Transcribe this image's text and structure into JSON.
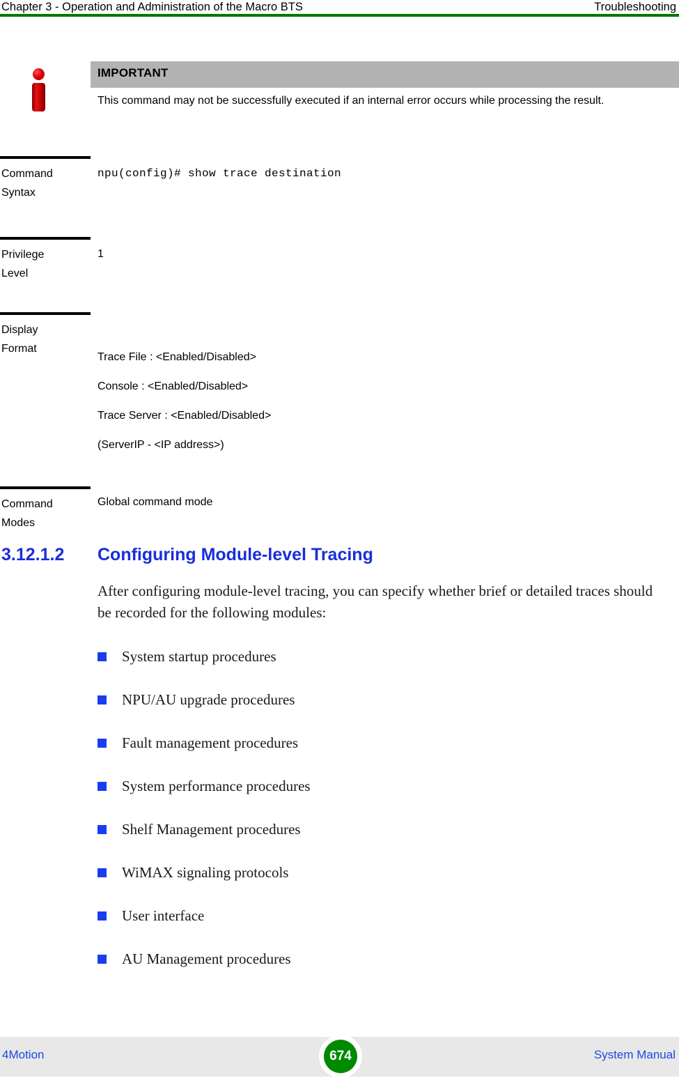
{
  "header": {
    "left": "Chapter 3 - Operation and Administration of the Macro BTS",
    "right": "Troubleshooting",
    "rule_color": "#007700"
  },
  "callout": {
    "icon": "info-icon",
    "title": "IMPORTANT",
    "body": "This command may not be successfully executed if an internal error occurs while processing the result.",
    "bar_color": "#b3b3b3",
    "icon_color": "#d00000"
  },
  "definition_table": {
    "rows": [
      {
        "term_line1": "Command",
        "term_line2": "Syntax",
        "value": "npu(config)# show trace destination"
      },
      {
        "term_line1": "Privilege",
        "term_line2": "Level",
        "value": "1"
      },
      {
        "term_line1": "Display",
        "term_line2": "Format",
        "lines": [
          "Trace File   : <Enabled/Disabled>",
          "Console : <Enabled/Disabled>",
          "Trace Server : <Enabled/Disabled>",
          "(ServerIP - <IP address>)"
        ]
      },
      {
        "term_line1": "Command",
        "term_line2": "Modes",
        "value": "Global command mode"
      }
    ]
  },
  "section": {
    "number": "3.12.1.2",
    "title": "Configuring Module-level Tracing",
    "color": "#1a2ed8",
    "paragraph": "After configuring module-level tracing, you can specify whether brief or detailed traces should be recorded for the following modules:"
  },
  "bullets": {
    "marker_color": "#1a3df0",
    "items": [
      "System startup procedures",
      "NPU/AU upgrade procedures",
      "Fault management procedures",
      "System performance procedures",
      "Shelf Management procedures",
      "WiMAX signaling protocols",
      "User interface",
      "AU Management procedures"
    ]
  },
  "footer": {
    "left": "4Motion",
    "page_number": "674",
    "right": "System Manual",
    "band_color": "#e8e8e8",
    "link_color": "#1a4ae0",
    "page_badge_color": "#008a00"
  }
}
